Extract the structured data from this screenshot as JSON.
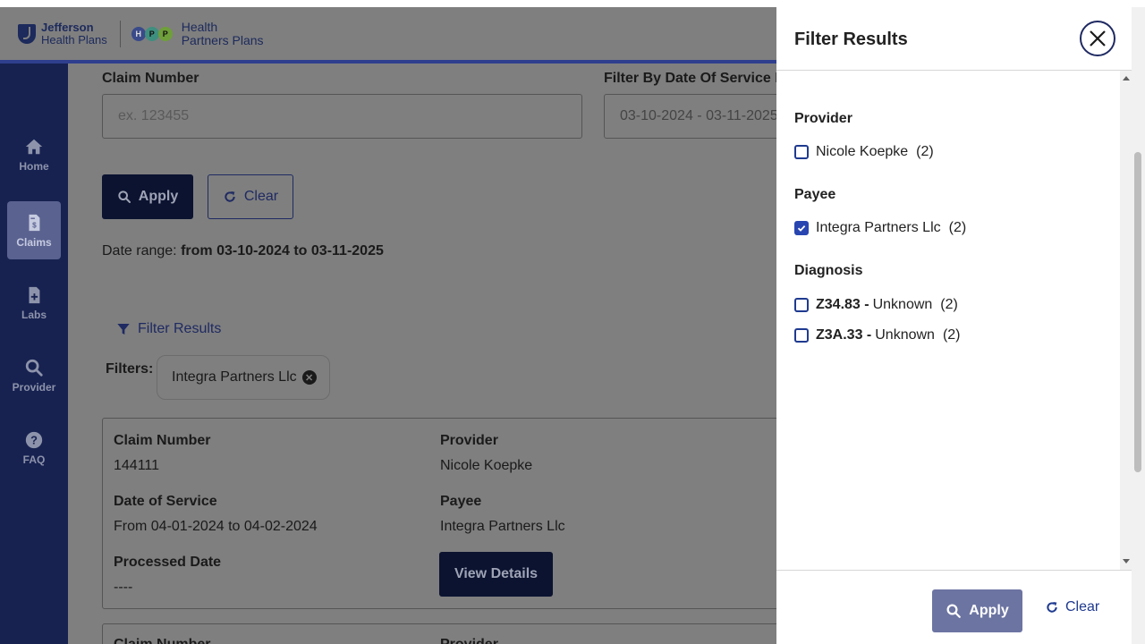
{
  "header": {
    "brand1_line1": "Jefferson",
    "brand1_line2": "Health Plans",
    "hpp_letters": [
      "H",
      "P",
      "P"
    ],
    "brand2_line1": "Health",
    "brand2_line2": "Partners Plans"
  },
  "sidebar": {
    "items": [
      {
        "label": "Home",
        "icon": "home-icon"
      },
      {
        "label": "Claims",
        "icon": "claims-document-icon"
      },
      {
        "label": "Labs",
        "icon": "labs-file-icon"
      },
      {
        "label": "Provider",
        "icon": "search-icon"
      },
      {
        "label": "FAQ",
        "icon": "question-icon"
      }
    ]
  },
  "search": {
    "claim_label": "Claim Number",
    "claim_placeholder": "ex. 123455",
    "date_label": "Filter By Date Of Service I",
    "date_value": "03-10-2024 - 03-11-2025",
    "apply_label": "Apply",
    "clear_label": "Clear",
    "range_prefix": "Date range:",
    "range_value": "from 03-10-2024 to 03-11-2025"
  },
  "filters": {
    "link_label": "Filter Results",
    "label": "Filters:",
    "chip": "Integra Partners Llc"
  },
  "claim": {
    "claim_number_label": "Claim Number",
    "claim_number": "144111",
    "provider_label": "Provider",
    "provider": "Nicole Koepke",
    "dos_label": "Date of Service",
    "dos": "From 04-01-2024 to 04-02-2024",
    "payee_label": "Payee",
    "payee": "Integra Partners Llc",
    "processed_label": "Processed Date",
    "processed": "----",
    "view_label": "View Details"
  },
  "claim2": {
    "claim_number_label": "Claim Number",
    "provider_label": "Provider"
  },
  "drawer": {
    "title": "Filter Results",
    "provider_title": "Provider",
    "provider_opt": {
      "name": "Nicole Koepke",
      "count": "(2)",
      "checked": false
    },
    "payee_title": "Payee",
    "payee_opt": {
      "name": "Integra Partners Llc",
      "count": "(2)",
      "checked": true
    },
    "diagnosis_title": "Diagnosis",
    "diag1": {
      "code": "Z34.83 -",
      "desc": "Unknown",
      "count": "(2)",
      "checked": false
    },
    "diag2": {
      "code": "Z3A.33 -",
      "desc": "Unknown",
      "count": "(2)",
      "checked": false
    },
    "apply_label": "Apply",
    "clear_label": "Clear"
  },
  "colors": {
    "navy": "#172251",
    "accent": "#1f3a8f",
    "apply_disabled": "#6c74a2"
  }
}
